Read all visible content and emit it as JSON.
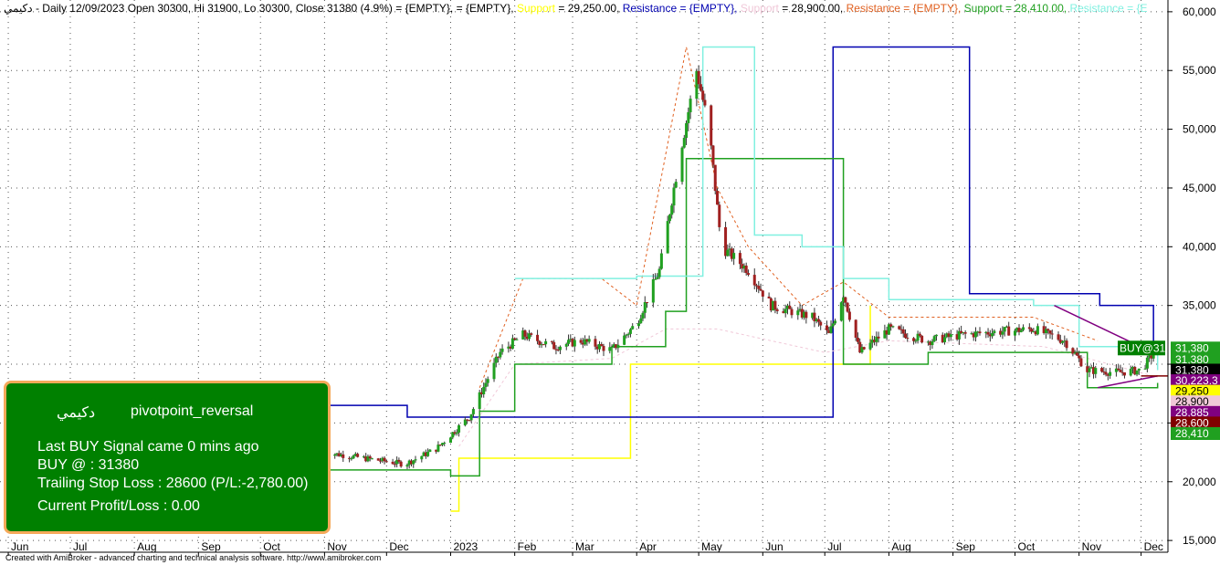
{
  "header": {
    "symbol": "دكيمي",
    "summary": " - Daily 12/09/2023 Open 30300, Hi 31900, Lo 30300, Close 31380 (4.9%)",
    "segments": [
      {
        "text": "= {EMPTY},",
        "color": "#000000"
      },
      {
        "text": "= {EMPTY},",
        "color": "#000000"
      },
      {
        "text": "Support",
        "color": "#ffff00"
      },
      {
        "text": "= 29,250.00,",
        "color": "#000000"
      },
      {
        "text": "Resistance = {EMPTY},",
        "color": "#0000b0"
      },
      {
        "text": "Support",
        "color": "#f0c8d8"
      },
      {
        "text": "= 28,900.00,",
        "color": "#000000"
      },
      {
        "text": "Resistance = {EMPTY},",
        "color": "#e06020"
      },
      {
        "text": "Support = 28,410.00,",
        "color": "#20a020"
      },
      {
        "text": "Resistance = {E",
        "color": "#80f0e0"
      }
    ]
  },
  "info_box": {
    "symbol": "دكيمي",
    "strategy": "pivotpoint_reversal",
    "line1": "Last BUY Signal came 0 mins ago",
    "line2": "BUY @  : 31380",
    "line3": "Trailing Stop Loss : 28600 (P/L:-2,780.00)",
    "line4": "Current Profit/Loss : 0.00"
  },
  "footer": "Created with AmiBroker - advanced charting and technical analysis software. http://www.amibroker.com",
  "buy_label": "BUY@31",
  "chart_data": {
    "type": "candlestick",
    "ylim": [
      14000,
      61000
    ],
    "y_ticks": [
      15000,
      20000,
      25000,
      30000,
      35000,
      40000,
      45000,
      50000,
      55000,
      60000
    ],
    "y_tick_labels": [
      "15,000",
      "20,000",
      "25,000",
      "30,000",
      "35,000",
      "40,000",
      "45,000",
      "50,000",
      "55,000",
      "60,000"
    ],
    "x_labels": [
      {
        "label": "Jun",
        "date": "2022-06-01"
      },
      {
        "label": "Jul",
        "date": "2022-07-01"
      },
      {
        "label": "Aug",
        "date": "2022-08-01"
      },
      {
        "label": "Sep",
        "date": "2022-09-01"
      },
      {
        "label": "Oct",
        "date": "2022-10-01"
      },
      {
        "label": "Nov",
        "date": "2022-11-01"
      },
      {
        "label": "Dec",
        "date": "2022-12-01"
      },
      {
        "label": "2023",
        "date": "2023-01-01"
      },
      {
        "label": "Feb",
        "date": "2023-02-01"
      },
      {
        "label": "Mar",
        "date": "2023-03-01"
      },
      {
        "label": "Apr",
        "date": "2023-04-01"
      },
      {
        "label": "May",
        "date": "2023-05-01"
      },
      {
        "label": "Jun",
        "date": "2023-06-01"
      },
      {
        "label": "Jul",
        "date": "2023-07-01"
      },
      {
        "label": "Aug",
        "date": "2023-08-01"
      },
      {
        "label": "Sep",
        "date": "2023-09-01"
      },
      {
        "label": "Oct",
        "date": "2023-10-01"
      },
      {
        "label": "Nov",
        "date": "2023-11-01"
      },
      {
        "label": "Dec",
        "date": "2023-12-01"
      }
    ],
    "x_range": [
      "2022-05-28",
      "2023-12-14"
    ],
    "last_bar": {
      "date": "2023-12-09",
      "open": 30300,
      "high": 31900,
      "low": 30300,
      "close": 31380
    },
    "price_path": [
      [
        "2022-11-01",
        22500
      ],
      [
        "2022-11-20",
        22000
      ],
      [
        "2022-12-10",
        21500
      ],
      [
        "2022-12-25",
        22800
      ],
      [
        "2023-01-10",
        25500
      ],
      [
        "2023-01-25",
        31000
      ],
      [
        "2023-02-05",
        32500
      ],
      [
        "2023-02-20",
        31500
      ],
      [
        "2023-03-05",
        32000
      ],
      [
        "2023-03-20",
        31200
      ],
      [
        "2023-04-01",
        33500
      ],
      [
        "2023-04-12",
        38000
      ],
      [
        "2023-04-22",
        48000
      ],
      [
        "2023-04-30",
        55000
      ],
      [
        "2023-05-06",
        50000
      ],
      [
        "2023-05-12",
        40000
      ],
      [
        "2023-05-25",
        38000
      ],
      [
        "2023-06-05",
        35000
      ],
      [
        "2023-06-25",
        34000
      ],
      [
        "2023-07-03",
        32500
      ],
      [
        "2023-07-10",
        36000
      ],
      [
        "2023-07-18",
        31000
      ],
      [
        "2023-08-01",
        33000
      ],
      [
        "2023-08-20",
        32000
      ],
      [
        "2023-09-05",
        32500
      ],
      [
        "2023-09-25",
        32800
      ],
      [
        "2023-10-10",
        33000
      ],
      [
        "2023-10-25",
        32000
      ],
      [
        "2023-11-05",
        29500
      ],
      [
        "2023-11-20",
        29300
      ],
      [
        "2023-12-01",
        29500
      ],
      [
        "2023-12-09",
        31380
      ]
    ],
    "series": [
      {
        "name": "Support",
        "color": "#ffff00",
        "style": "step",
        "points": [
          [
            "2023-01-01",
            17500
          ],
          [
            "2023-01-05",
            22000
          ],
          [
            "2023-03-28",
            22000
          ],
          [
            "2023-03-29",
            30000
          ],
          [
            "2023-07-22",
            30000
          ],
          [
            "2023-07-23",
            35000
          ]
        ]
      },
      {
        "name": "Resistance",
        "color": "#0000b0",
        "style": "step",
        "points": [
          [
            "2022-11-01",
            26500
          ],
          [
            "2022-12-10",
            26500
          ],
          [
            "2022-12-11",
            25500
          ],
          [
            "2022-12-20",
            25500
          ],
          [
            "2023-07-05",
            57000
          ],
          [
            "2023-09-05",
            57000
          ],
          [
            "2023-09-09",
            36000
          ],
          [
            "2023-11-10",
            36000
          ],
          [
            "2023-11-11",
            35000
          ],
          [
            "2023-12-05",
            35000
          ],
          [
            "2023-12-07",
            31500
          ]
        ]
      },
      {
        "name": "Support",
        "color": "#f0c8d8",
        "style": "dashed",
        "points": [
          [
            "2023-01-05",
            23000
          ],
          [
            "2023-02-01",
            30000
          ],
          [
            "2023-03-20",
            30500
          ],
          [
            "2023-04-15",
            33000
          ],
          [
            "2023-05-10",
            33000
          ],
          [
            "2023-07-01",
            31000
          ],
          [
            "2023-08-01",
            32000
          ],
          [
            "2023-10-15",
            31500
          ],
          [
            "2023-12-09",
            28900
          ]
        ]
      },
      {
        "name": "Resistance",
        "color": "#e06020",
        "style": "dashed",
        "points": [
          [
            "2023-01-15",
            28000
          ],
          [
            "2023-02-05",
            37300
          ],
          [
            "2023-03-15",
            37300
          ],
          [
            "2023-04-01",
            35000
          ],
          [
            "2023-04-25",
            57000
          ],
          [
            "2023-05-10",
            45000
          ],
          [
            "2023-05-25",
            40000
          ],
          [
            "2023-06-20",
            35000
          ],
          [
            "2023-07-10",
            37000
          ],
          [
            "2023-08-01",
            34000
          ],
          [
            "2023-10-10",
            34000
          ],
          [
            "2023-11-10",
            32000
          ]
        ]
      },
      {
        "name": "Support",
        "color": "#20a020",
        "style": "step",
        "points": [
          [
            "2022-11-01",
            21000
          ],
          [
            "2022-12-05",
            21000
          ],
          [
            "2023-01-01",
            20500
          ],
          [
            "2023-01-15",
            26000
          ],
          [
            "2023-02-01",
            30000
          ],
          [
            "2023-03-20",
            31500
          ],
          [
            "2023-04-15",
            34500
          ],
          [
            "2023-04-25",
            47500
          ],
          [
            "2023-07-10",
            30000
          ],
          [
            "2023-08-20",
            31000
          ],
          [
            "2023-11-05",
            28000
          ],
          [
            "2023-12-09",
            28410
          ]
        ]
      },
      {
        "name": "Resistance",
        "color": "#80f0e0",
        "style": "step",
        "points": [
          [
            "2023-02-01",
            37300
          ],
          [
            "2023-04-01",
            37500
          ],
          [
            "2023-05-03",
            57000
          ],
          [
            "2023-05-20",
            57000
          ],
          [
            "2023-05-28",
            41000
          ],
          [
            "2023-06-20",
            40000
          ],
          [
            "2023-07-10",
            37300
          ],
          [
            "2023-08-01",
            35500
          ],
          [
            "2023-10-10",
            35000
          ],
          [
            "2023-11-01",
            31500
          ],
          [
            "2023-12-09",
            29500
          ]
        ]
      }
    ],
    "trendlines": [
      {
        "color": "#800080",
        "from": [
          "2023-10-20",
          35000
        ],
        "to": [
          "2023-12-09",
          30800
        ]
      },
      {
        "color": "#800080",
        "from": [
          "2023-11-10",
          28000
        ],
        "to": [
          "2023-12-09",
          29000
        ]
      },
      {
        "color": "#800000",
        "from": [
          "2023-12-01",
          29000
        ],
        "to": [
          "2023-12-14",
          29000
        ]
      }
    ],
    "price_labels": [
      {
        "value": "31,380",
        "bg": "#20a020",
        "fg": "#ffffff",
        "level": 31380
      },
      {
        "value": "31,380",
        "bg": "#20a020",
        "fg": "#ffffff",
        "level": 30400
      },
      {
        "value": "31,380",
        "bg": "#000000",
        "fg": "#ffffff",
        "level": 29500
      },
      {
        "value": "30,223.3",
        "bg": "#800080",
        "fg": "#ffffff",
        "level": 28600
      },
      {
        "value": "29,250",
        "bg": "#ffff00",
        "fg": "#000000",
        "level": 27700
      },
      {
        "value": "28,900",
        "bg": "#f0c8d8",
        "fg": "#000000",
        "level": 26800
      },
      {
        "value": "28,885",
        "bg": "#800080",
        "fg": "#ffffff",
        "level": 25900
      },
      {
        "value": "28,600",
        "bg": "#800000",
        "fg": "#ffffff",
        "level": 25000
      },
      {
        "value": "28,410",
        "bg": "#20a020",
        "fg": "#ffffff",
        "level": 24100
      }
    ]
  }
}
